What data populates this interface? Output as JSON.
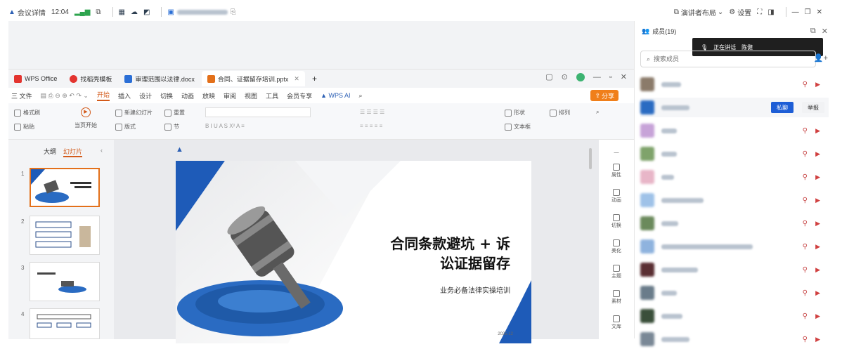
{
  "topbar": {
    "meeting_label": "会议详情",
    "time": "12:04",
    "meeting_id": "",
    "right_items": [
      "演讲者布局",
      "设置"
    ]
  },
  "wps": {
    "tabs": [
      {
        "label": "WPS Office",
        "color": "#e3342f"
      },
      {
        "label": "找稻壳模板",
        "color": "#e3342f"
      },
      {
        "label": "审理范围以法律.docx",
        "color": "#2b6fd6"
      },
      {
        "label": "合同、证据留存培训.pptx",
        "color": "#e3701a"
      }
    ],
    "menu": [
      "三 文件",
      "开始",
      "插入",
      "设计",
      "切换",
      "动画",
      "放映",
      "审阅",
      "视图",
      "工具",
      "会员专享",
      "WPS AI"
    ],
    "active_menu": "开始",
    "share_label": "分享",
    "ribbon": [
      "格式刷",
      "粘贴",
      "当页开始",
      "新建幻灯片",
      "版式",
      "重置",
      "节",
      "形状",
      "文本框",
      "排列",
      "查找"
    ],
    "left_tabs": [
      "大纲",
      "幻灯片"
    ],
    "slide_numbers": [
      "1",
      "2",
      "3",
      "4"
    ],
    "slide": {
      "title_line1": "合同条款避坑 + 诉",
      "title_line2": "讼证据留存",
      "subtitle": "业务必备法律实操培训",
      "date": "2025.12"
    },
    "right_tools": [
      "属性",
      "动画",
      "切换",
      "美化",
      "主题",
      "素材",
      "文库"
    ]
  },
  "panel": {
    "title": "成员(19)",
    "search_placeholder": "搜索成员",
    "tooltip_text": "正在讲话",
    "tooltip_name": "陈健",
    "btn_private": "私聊",
    "btn_more": "举报",
    "members": [
      {
        "avatar_color": "#8b7b6a"
      },
      {
        "avatar_color": "#2a6bc2",
        "highlight": true
      },
      {
        "avatar_color": "#c7a3d8"
      },
      {
        "avatar_color": "#7fa36b"
      },
      {
        "avatar_color": "#e8b6c8"
      },
      {
        "avatar_color": "#9fc2e8"
      },
      {
        "avatar_color": "#6b8a5c"
      },
      {
        "avatar_color": "#8fb3de"
      },
      {
        "avatar_color": "#5a2f33"
      },
      {
        "avatar_color": "#6a7c8a"
      },
      {
        "avatar_color": "#3a4f3a"
      },
      {
        "avatar_color": "#7a8896"
      }
    ]
  }
}
